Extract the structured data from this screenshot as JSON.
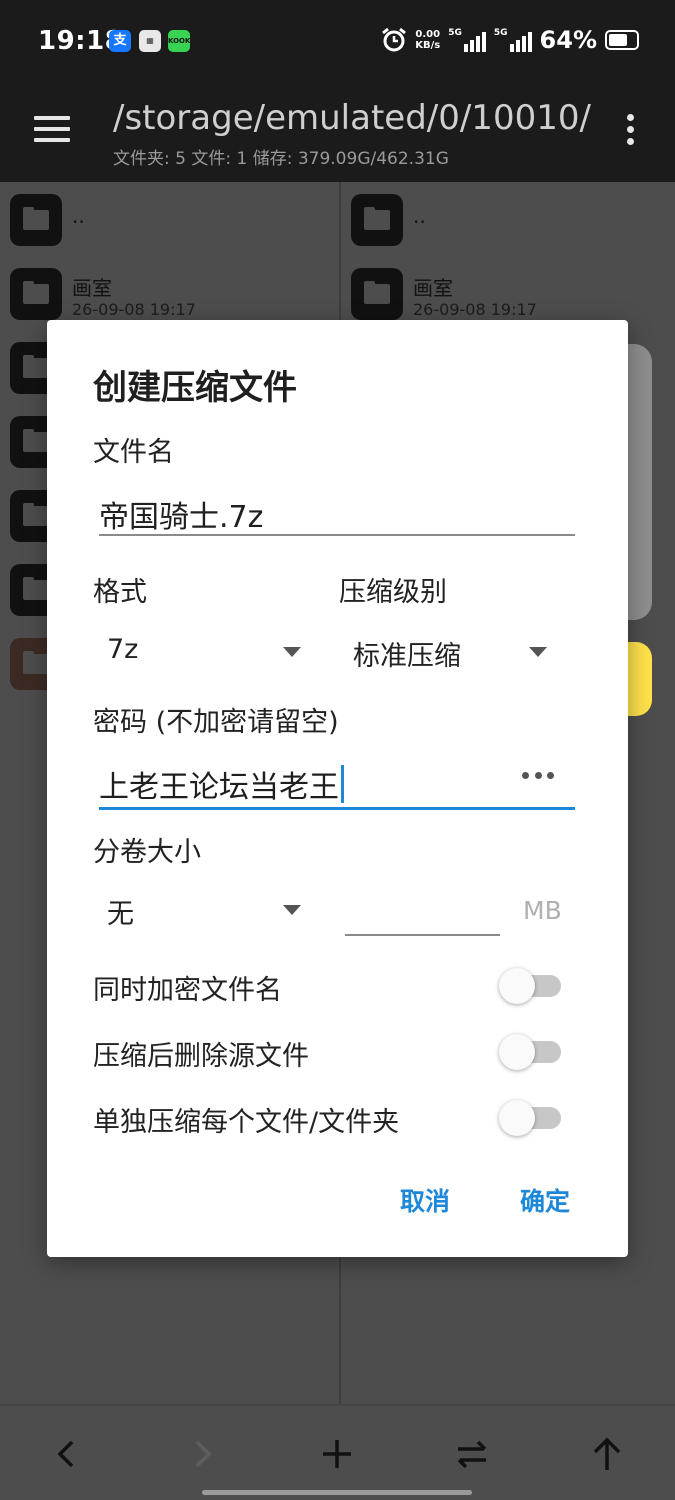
{
  "status_bar": {
    "time": "19:18",
    "app_icons": [
      "支",
      "▦",
      "KOOK"
    ],
    "net_speed_value": "0.00",
    "net_speed_unit": "KB/s",
    "signal1_label": "5G",
    "signal2_label": "5G",
    "battery_percent": "64%"
  },
  "toolbar": {
    "path": "/storage/emulated/0/10010/",
    "summary": "文件夹: 5  文件: 1  储存: 379.09G/462.31G"
  },
  "left_pane": {
    "items": [
      {
        "name": "..",
        "date": ""
      },
      {
        "name": "画室",
        "date": "26-09-08 19:17"
      }
    ]
  },
  "right_pane": {
    "items": [
      {
        "name": "..",
        "date": ""
      },
      {
        "name": "画室",
        "date": "26-09-08 19:17"
      }
    ]
  },
  "dialog": {
    "title": "创建压缩文件",
    "filename_label": "文件名",
    "filename_value": "帝国骑士.7z",
    "format_label": "格式",
    "format_value": "7z",
    "level_label": "压缩级别",
    "level_value": "标准压缩",
    "password_label": "密码 (不加密请留空)",
    "password_value": "上老王论坛当老王",
    "volume_label": "分卷大小",
    "volume_value": "无",
    "volume_size_value": "",
    "volume_unit": "MB",
    "encrypt_names_label": "同时加密文件名",
    "encrypt_names_on": false,
    "delete_source_label": "压缩后删除源文件",
    "delete_source_on": false,
    "separate_label": "单独压缩每个文件/文件夹",
    "separate_on": false,
    "cancel_label": "取消",
    "ok_label": "确定"
  },
  "bottom_bar": {
    "buttons": [
      "back-icon",
      "forward-icon",
      "add-icon",
      "swap-icon",
      "up-icon"
    ],
    "forward_enabled": false
  },
  "colors": {
    "accent": "#1e88d8",
    "floating_bell": "#ffe14a",
    "scrim": "#4d4d4d"
  }
}
